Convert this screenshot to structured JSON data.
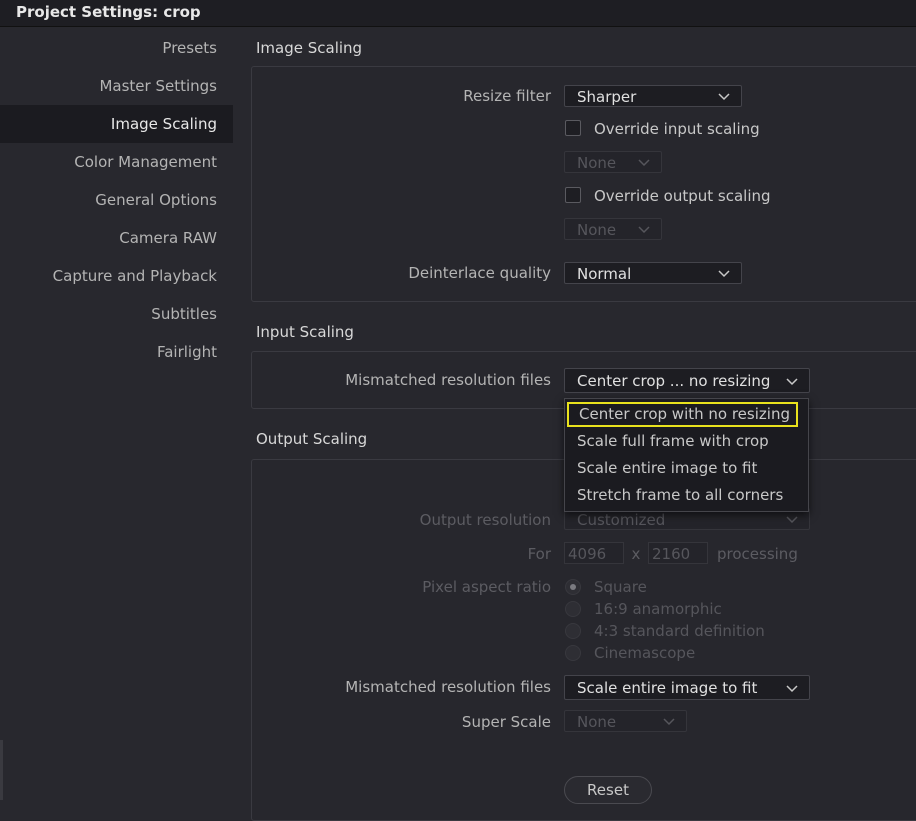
{
  "window": {
    "title": "Project Settings:  crop"
  },
  "sidebar": {
    "items": [
      {
        "label": "Presets"
      },
      {
        "label": "Master Settings"
      },
      {
        "label": "Image Scaling"
      },
      {
        "label": "Color Management"
      },
      {
        "label": "General Options"
      },
      {
        "label": "Camera RAW"
      },
      {
        "label": "Capture and Playback"
      },
      {
        "label": "Subtitles"
      },
      {
        "label": "Fairlight"
      }
    ]
  },
  "image_scaling": {
    "title": "Image Scaling",
    "resize_filter_label": "Resize filter",
    "resize_filter_value": "Sharper",
    "override_input_label": "Override input scaling",
    "override_input_value": "None",
    "override_output_label": "Override output scaling",
    "override_output_value": "None",
    "deinterlace_label": "Deinterlace quality",
    "deinterlace_value": "Normal"
  },
  "input_scaling": {
    "title": "Input Scaling",
    "mismatched_label": "Mismatched resolution files",
    "mismatched_value": "Center crop ... no resizing",
    "options": [
      "Center crop with no resizing",
      "Scale full frame with crop",
      "Scale entire image to fit",
      "Stretch frame to all corners"
    ]
  },
  "output_scaling": {
    "title": "Output Scaling",
    "resolution_label": "Output resolution",
    "resolution_value": "Customized",
    "for_label": "For",
    "width": "4096",
    "x_label": "x",
    "height": "2160",
    "processing_label": "processing",
    "pixel_aspect_label": "Pixel aspect ratio",
    "pixel_aspect_options": [
      "Square",
      "16:9 anamorphic",
      "4:3 standard definition",
      "Cinemascope"
    ],
    "mismatched_label": "Mismatched resolution files",
    "mismatched_value": "Scale entire image to fit",
    "super_scale_label": "Super Scale",
    "super_scale_value": "None",
    "reset_label": "Reset"
  },
  "colors": {
    "background": "#28282e",
    "highlight": "#e9e21d"
  }
}
